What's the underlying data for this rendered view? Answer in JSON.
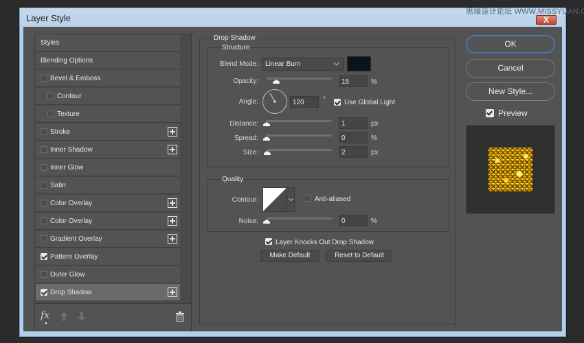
{
  "window": {
    "title": "Layer Style",
    "watermark": "思缘设计论坛 WWW.MISSYUAN.COM",
    "close_label": "X"
  },
  "style_list": {
    "items": [
      {
        "label": "Styles",
        "has_checkbox": false,
        "checked": false,
        "has_plus": false,
        "indent": false,
        "selected": false
      },
      {
        "label": "Blending Options",
        "has_checkbox": false,
        "checked": false,
        "has_plus": false,
        "indent": false,
        "selected": false
      },
      {
        "label": "Bevel & Emboss",
        "has_checkbox": true,
        "checked": false,
        "has_plus": false,
        "indent": false,
        "selected": false
      },
      {
        "label": "Contour",
        "has_checkbox": true,
        "checked": false,
        "has_plus": false,
        "indent": true,
        "selected": false
      },
      {
        "label": "Texture",
        "has_checkbox": true,
        "checked": false,
        "has_plus": false,
        "indent": true,
        "selected": false
      },
      {
        "label": "Stroke",
        "has_checkbox": true,
        "checked": false,
        "has_plus": true,
        "indent": false,
        "selected": false
      },
      {
        "label": "Inner Shadow",
        "has_checkbox": true,
        "checked": false,
        "has_plus": true,
        "indent": false,
        "selected": false
      },
      {
        "label": "Inner Glow",
        "has_checkbox": true,
        "checked": false,
        "has_plus": false,
        "indent": false,
        "selected": false
      },
      {
        "label": "Satin",
        "has_checkbox": true,
        "checked": false,
        "has_plus": false,
        "indent": false,
        "selected": false
      },
      {
        "label": "Color Overlay",
        "has_checkbox": true,
        "checked": false,
        "has_plus": true,
        "indent": false,
        "selected": false
      },
      {
        "label": "Color Overlay",
        "has_checkbox": true,
        "checked": false,
        "has_plus": true,
        "indent": false,
        "selected": false
      },
      {
        "label": "Gradient Overlay",
        "has_checkbox": true,
        "checked": false,
        "has_plus": true,
        "indent": false,
        "selected": false
      },
      {
        "label": "Pattern Overlay",
        "has_checkbox": true,
        "checked": true,
        "has_plus": false,
        "indent": false,
        "selected": false
      },
      {
        "label": "Outer Glow",
        "has_checkbox": true,
        "checked": false,
        "has_plus": false,
        "indent": false,
        "selected": false
      },
      {
        "label": "Drop Shadow",
        "has_checkbox": true,
        "checked": true,
        "has_plus": true,
        "indent": false,
        "selected": true
      }
    ],
    "footer": {
      "fx_label": "fx"
    }
  },
  "drop_shadow": {
    "section_title": "Drop Shadow",
    "structure": {
      "title": "Structure",
      "blend_mode_label": "Blend Mode:",
      "blend_mode_value": "Linear Burn",
      "shadow_color": "#0d131b",
      "opacity_label": "Opacity:",
      "opacity_value": "15",
      "opacity_unit": "%",
      "opacity_fraction": 0.15,
      "angle_label": "Angle:",
      "angle_value": "120",
      "angle_unit": "°",
      "angle_degrees": 120,
      "use_global_light_label": "Use Global Light",
      "use_global_light_checked": true,
      "distance_label": "Distance:",
      "distance_value": "1",
      "distance_unit": "px",
      "distance_fraction": 0.0,
      "spread_label": "Spread:",
      "spread_value": "0",
      "spread_unit": "%",
      "spread_fraction": 0.0,
      "size_label": "Size:",
      "size_value": "2",
      "size_unit": "px",
      "size_fraction": 0.01
    },
    "quality": {
      "title": "Quality",
      "contour_label": "Contour:",
      "anti_aliased_label": "Anti-aliased",
      "anti_aliased_checked": false,
      "noise_label": "Noise:",
      "noise_value": "0",
      "noise_unit": "%",
      "noise_fraction": 0.0
    },
    "knocks_out_label": "Layer Knocks Out Drop Shadow",
    "knocks_out_checked": true,
    "make_default_label": "Make Default",
    "reset_default_label": "Reset to Default"
  },
  "actions": {
    "ok_label": "OK",
    "cancel_label": "Cancel",
    "new_style_label": "New Style...",
    "preview_label": "Preview",
    "preview_checked": true
  }
}
